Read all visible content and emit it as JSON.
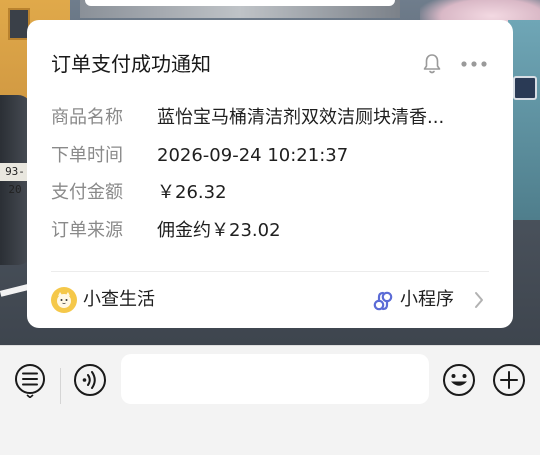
{
  "card": {
    "title": "订单支付成功通知",
    "rows": [
      {
        "label": "商品名称",
        "value": "蓝怡宝马桶清洁剂双效洁厕块清香..."
      },
      {
        "label": "下单时间",
        "value": "2026-09-24 10:21:37"
      },
      {
        "label": "支付金额",
        "value": "￥26.32"
      },
      {
        "label": "订单来源",
        "value": "佣金约￥23.02"
      }
    ],
    "footer": {
      "name": "小查生活",
      "type": "小程序"
    }
  },
  "background": {
    "plate_text": "93-20"
  },
  "input": {
    "value": ""
  },
  "icons": {
    "bell": "bell-icon",
    "more": "more-icon",
    "miniprogram_link": "link-icon",
    "chevron": "chevron-right-icon",
    "menu": "menu-icon",
    "voice": "voice-icon",
    "emoji": "emoji-icon",
    "plus": "plus-icon"
  },
  "colors": {
    "card_bg": "#ffffff",
    "label_gray": "#8a8a8a",
    "text_dark": "#1f1f1f",
    "miniprogram_blue": "#5b6bd6",
    "avatar_yellow": "#f5c84a"
  }
}
